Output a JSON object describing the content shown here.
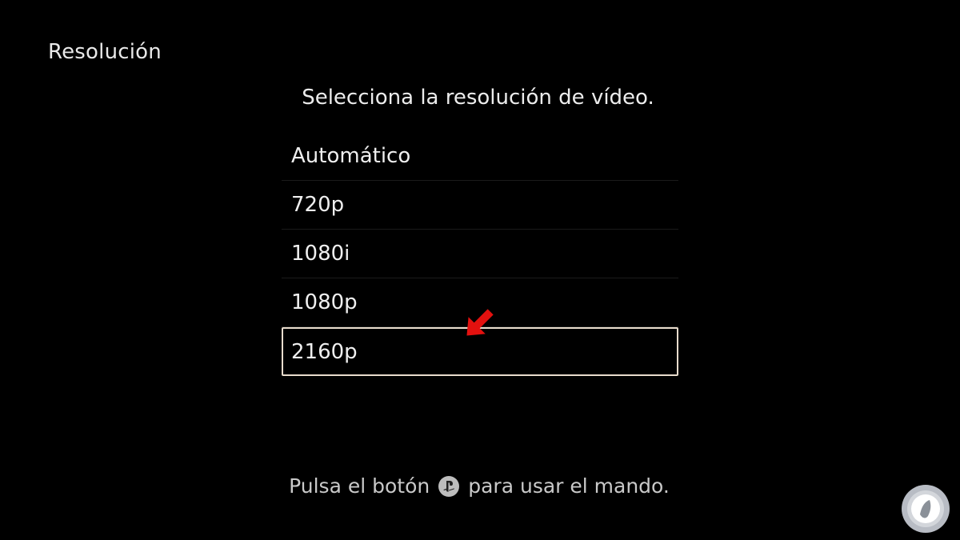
{
  "header": {
    "title": "Resolución"
  },
  "main": {
    "instruction": "Selecciona la resolución de vídeo.",
    "options": [
      {
        "label": "Automático",
        "selected": false
      },
      {
        "label": "720p",
        "selected": false
      },
      {
        "label": "1080i",
        "selected": false
      },
      {
        "label": "1080p",
        "selected": false
      },
      {
        "label": "2160p",
        "selected": true
      }
    ],
    "selected_value": "2160p"
  },
  "footer": {
    "hint_before": "Pulsa el botón",
    "hint_icon": "playstation-button-icon",
    "hint_after": "para usar el mando."
  },
  "annotation": {
    "arrow_icon": "red-arrow-icon",
    "color": "#e3110f"
  },
  "watermark": {
    "icon": "logo-watermark-icon"
  },
  "colors": {
    "background": "#000000",
    "text": "#efefef",
    "selection_border": "#e8dccd",
    "divider": "#1b1b1b",
    "arrow": "#e3110f"
  }
}
